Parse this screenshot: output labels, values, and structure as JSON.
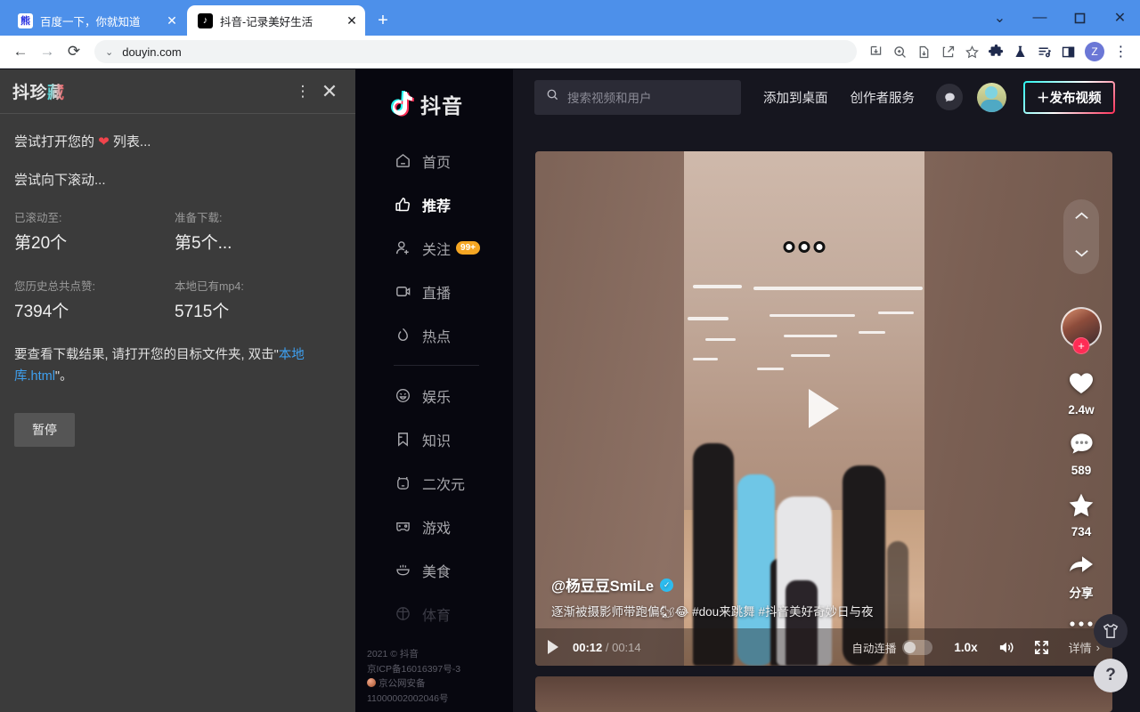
{
  "browser": {
    "tabs": [
      {
        "title": "百度一下，你就知道",
        "favicon": "baidu-icon",
        "active": false
      },
      {
        "title": "抖音-记录美好生活",
        "favicon": "douyin-icon",
        "active": true
      }
    ],
    "new_tab_label": "+",
    "window_controls": {
      "chevron": "⌄",
      "minimize": "—",
      "maximize": "▢",
      "close": "✕"
    },
    "nav": {
      "back": "←",
      "forward": "→",
      "reload": "⟳"
    },
    "omnibox": {
      "url": "douyin.com",
      "chevron": "⌄"
    },
    "toolbar_icons": [
      "downloads-icon",
      "zoom-icon",
      "page-save-icon",
      "share-icon",
      "bookmark-star-icon",
      "extensions-puzzle-icon",
      "flask-icon",
      "reading-list-icon",
      "side-panel-icon"
    ],
    "profile_initial": "Z",
    "menu_icon": "⋮"
  },
  "extension": {
    "title_prefix": "抖珍",
    "title_glitch": "藏",
    "menu_icon": "⋮",
    "close_icon": "✕",
    "status_line1": "尝试打开您的 ❤ 列表...",
    "status_line1_pre": "尝试打开您的 ",
    "status_line1_heart": "❤",
    "status_line1_post": " 列表...",
    "status_line2": "尝试向下滚动...",
    "stats": [
      {
        "label": "已滚动至:",
        "value": "第20个"
      },
      {
        "label": "准备下载:",
        "value": "第5个..."
      },
      {
        "label": "您历史总共点赞:",
        "value": "7394个"
      },
      {
        "label": "本地已有mp4:",
        "value": "5715个"
      }
    ],
    "note_pre": "要查看下载结果, 请打开您的目标文件夹, 双击\"",
    "note_link": "本地库.html",
    "note_post": "\"。",
    "pause_button": "暂停"
  },
  "douyin": {
    "brand": "抖音",
    "nav_items": [
      {
        "label": "首页",
        "icon": "home-icon",
        "state": "normal"
      },
      {
        "label": "推荐",
        "icon": "thumbs-up-icon",
        "state": "active"
      },
      {
        "label": "关注",
        "icon": "user-plus-icon",
        "state": "normal",
        "badge": "99+"
      },
      {
        "label": "直播",
        "icon": "live-icon",
        "state": "normal"
      },
      {
        "label": "热点",
        "icon": "flame-icon",
        "state": "normal"
      }
    ],
    "nav_items2": [
      {
        "label": "娱乐",
        "icon": "smiley-icon",
        "state": "normal"
      },
      {
        "label": "知识",
        "icon": "bookmark-icon",
        "state": "normal"
      },
      {
        "label": "二次元",
        "icon": "bear-icon",
        "state": "normal"
      },
      {
        "label": "游戏",
        "icon": "gamepad-icon",
        "state": "normal"
      },
      {
        "label": "美食",
        "icon": "bowl-icon",
        "state": "normal"
      },
      {
        "label": "体育",
        "icon": "sports-icon",
        "state": "faded"
      }
    ],
    "footer": {
      "copyright": "2021 © 抖音",
      "icp": "京ICP备16016397号-3",
      "police_label": "京公网安备",
      "police_number": "11000002002046号"
    },
    "header": {
      "search_placeholder": "搜索视频和用户",
      "search_icon": "search-icon",
      "links": [
        "添加到桌面",
        "创作者服务"
      ],
      "message_icon": "message-icon",
      "avatar": "user-avatar",
      "publish_button": "＋发布视频"
    },
    "video": {
      "author": "@杨豆豆SmiLe",
      "verified_icon": "verified-badge-icon",
      "description": "逐渐被摄影师带跑偏🐿😂 #dou来跳舞  #抖音美好奇妙日与夜",
      "overlay_text": "ooo",
      "controls": {
        "play_icon": "play-icon",
        "current_time": "00:12",
        "total_time": "00:14",
        "autoplay_label": "自动连播",
        "autoplay_on": false,
        "rate": "1.0x",
        "volume_icon": "volume-icon",
        "fullscreen_icon": "fullscreen-icon",
        "detail_label": "详情",
        "detail_chevron": "›"
      },
      "rail": {
        "up_icon": "chevron-up-icon",
        "down_icon": "chevron-down-icon",
        "follow_plus": "+",
        "actions": [
          {
            "icon": "heart-icon",
            "count": "2.4w"
          },
          {
            "icon": "comment-icon",
            "count": "589"
          },
          {
            "icon": "star-icon",
            "count": "734"
          },
          {
            "icon": "share-arrow-icon",
            "count": "分享"
          },
          {
            "icon": "more-dots-icon",
            "count": ""
          }
        ]
      }
    },
    "fabs": [
      {
        "icon": "shirt-icon",
        "name": "merch-button"
      },
      {
        "icon": "?",
        "name": "help-button"
      }
    ]
  },
  "colors": {
    "chrome_blue": "#4d90ea",
    "douyin_bg": "#16161f",
    "sidebar_bg": "#07070f",
    "accent_red": "#fe2c55",
    "accent_cyan": "#25f4ee",
    "badge_orange": "#f5a623",
    "link_blue": "#3ea0f0"
  }
}
